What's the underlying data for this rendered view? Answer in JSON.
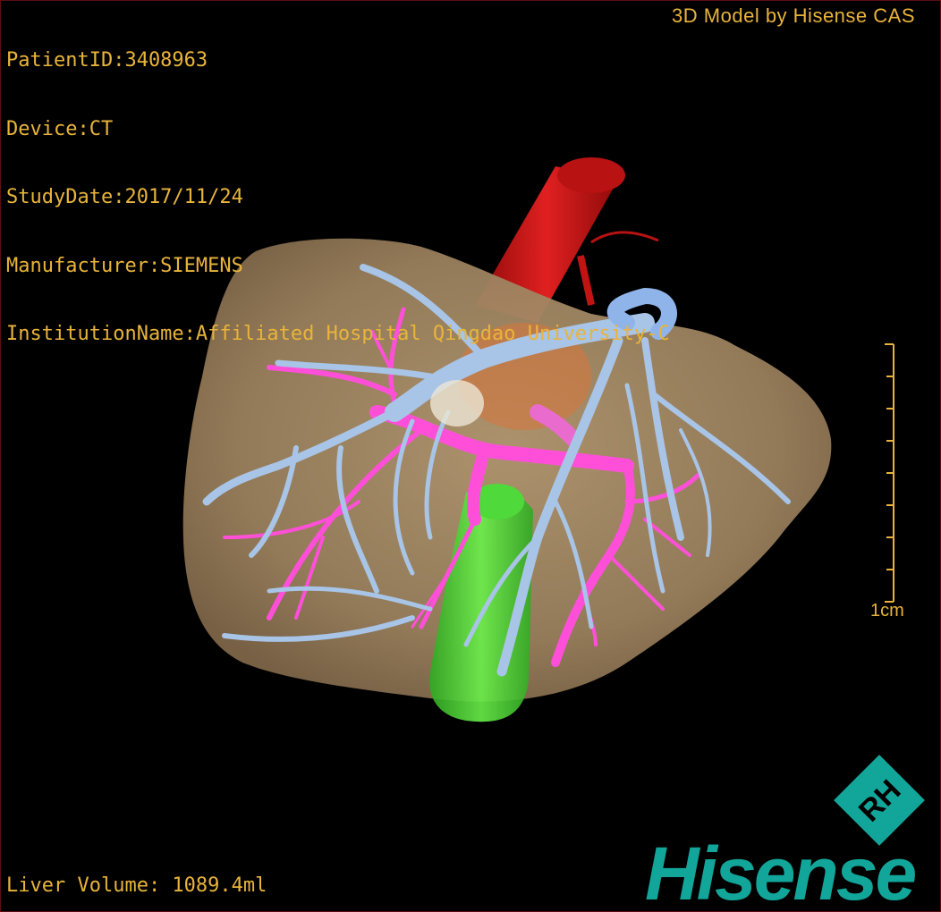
{
  "header": {
    "patient_id": "PatientID:3408963",
    "device": "Device:CT",
    "study_date": "StudyDate:2017/11/24",
    "manufacturer": "Manufacturer:SIEMENS",
    "institution": "InstitutionName:Affiliated Hospital Qingdao University-C"
  },
  "brand_text": "3D Model by Hisense CAS",
  "footer": {
    "liver_volume": "Liver Volume: 1089.4ml"
  },
  "scale": {
    "label": "1cm"
  },
  "logo": {
    "emblem_letters": "RH",
    "wordmark": "Hisense"
  },
  "colors": {
    "overlay_text": "#e9b43a",
    "liver": "#9a805d",
    "hepatic_vein": "#a8c4e6",
    "portal_vein": "#ff55dd",
    "aorta": "#cc1616",
    "ivc_green": "#44dd33",
    "brand_teal": "#12a69b"
  }
}
